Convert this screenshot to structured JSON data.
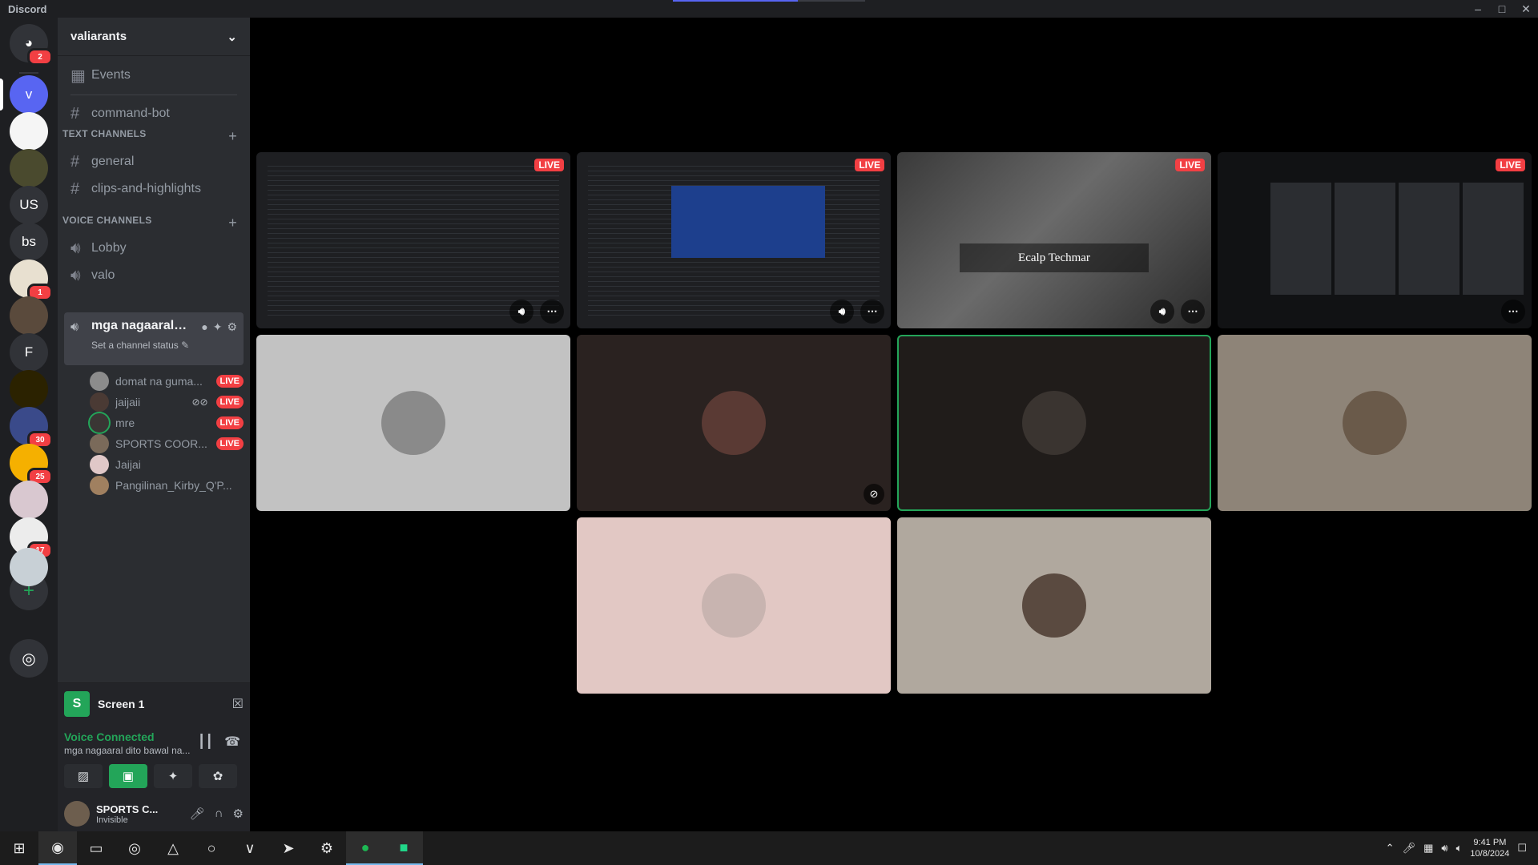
{
  "app": {
    "title": "Discord",
    "loading_progress": 0.65
  },
  "guilds": [
    {
      "name": "home",
      "label": "",
      "color": "#313338",
      "badge": "2"
    },
    {
      "name": "guild-v",
      "label": "v",
      "color": "#5865f2",
      "badge": ""
    },
    {
      "name": "guild-mazai",
      "label": "",
      "color": "#f5f5f5",
      "badge": ""
    },
    {
      "name": "guild-cat",
      "label": "",
      "color": "#4a4a2e",
      "badge": ""
    },
    {
      "name": "guild-us",
      "label": "US",
      "color": "#313338",
      "badge": ""
    },
    {
      "name": "guild-bs",
      "label": "bs",
      "color": "#313338",
      "badge": ""
    },
    {
      "name": "guild-map",
      "label": "",
      "color": "#e8e0d0",
      "badge": "1"
    },
    {
      "name": "guild-face",
      "label": "",
      "color": "#5a4a3c",
      "badge": ""
    },
    {
      "name": "guild-f",
      "label": "F",
      "color": "#313338",
      "badge": ""
    },
    {
      "name": "guild-emblem",
      "label": "",
      "color": "#2b2200",
      "badge": ""
    },
    {
      "name": "guild-anime",
      "label": "",
      "color": "#3a4a8a",
      "badge": "30"
    },
    {
      "name": "guild-emoji",
      "label": "",
      "color": "#f5b000",
      "badge": "25"
    },
    {
      "name": "guild-girl",
      "label": "",
      "color": "#d9c8d0",
      "badge": ""
    },
    {
      "name": "guild-sketch",
      "label": "",
      "color": "#ececec",
      "badge": "17"
    },
    {
      "name": "guild-blank",
      "label": "",
      "color": "#c8d0d6",
      "badge": ""
    }
  ],
  "server": {
    "name": "valiarants"
  },
  "channels": {
    "events": "Events",
    "command_bot": "command-bot",
    "text_category": "TEXT CHANNELS",
    "text": [
      "general",
      "clips-and-highlights"
    ],
    "voice_category": "VOICE CHANNELS",
    "voice": [
      "Lobby",
      "valo"
    ],
    "active_voice": {
      "name": "mga nagaaral di...",
      "status": "Set a channel status"
    },
    "voice_users": [
      {
        "name": "domat na guma...",
        "live": "LIVE",
        "color": "#8c8c8c"
      },
      {
        "name": "jaijaii",
        "live": "LIVE",
        "color": "#4a3a34"
      },
      {
        "name": "mre",
        "live": "LIVE",
        "color": "#3a3634"
      },
      {
        "name": "SPORTS COOR...",
        "live": "LIVE",
        "color": "#7a6a5a"
      },
      {
        "name": "Jaijai",
        "live": "",
        "color": "#e0c8c8"
      },
      {
        "name": "Pangilinan_Kirby_Q'P...",
        "live": "",
        "color": "#a08060"
      }
    ]
  },
  "screen_share": {
    "label": "Screen 1",
    "icon_letter": "S"
  },
  "voice_panel": {
    "connected": "Voice Connected",
    "channel": "mga nagaaral dito bawal na..."
  },
  "user": {
    "name": "SPORTS C...",
    "status": "Invisible"
  },
  "stream_tiles": [
    {
      "kind": "code",
      "live": "LIVE"
    },
    {
      "kind": "code-selected",
      "live": "LIVE"
    },
    {
      "kind": "website",
      "live": "LIVE",
      "caption": "Ecalp Techmar"
    },
    {
      "kind": "discord",
      "live": "LIVE"
    }
  ],
  "camera_tiles": [
    {
      "bg": "#c2c2c2",
      "avatar": "#8a8a8a",
      "speaking": false,
      "muted": false
    },
    {
      "bg": "#2a2220",
      "avatar": "#5a3a34",
      "speaking": false,
      "muted": true
    },
    {
      "bg": "#201c1a",
      "avatar": "#3a3430",
      "speaking": true,
      "muted": false
    },
    {
      "bg": "#8e8478",
      "avatar": "#6a5a4a",
      "speaking": false,
      "muted": false
    },
    {
      "bg": "#e2c8c4",
      "avatar": "#c8b4b0",
      "speaking": false,
      "muted": false
    },
    {
      "bg": "#b0a89e",
      "avatar": "#5a4a40",
      "speaking": false,
      "muted": false
    }
  ],
  "taskbar": {
    "time": "9:41 PM",
    "date": "10/8/2024"
  }
}
